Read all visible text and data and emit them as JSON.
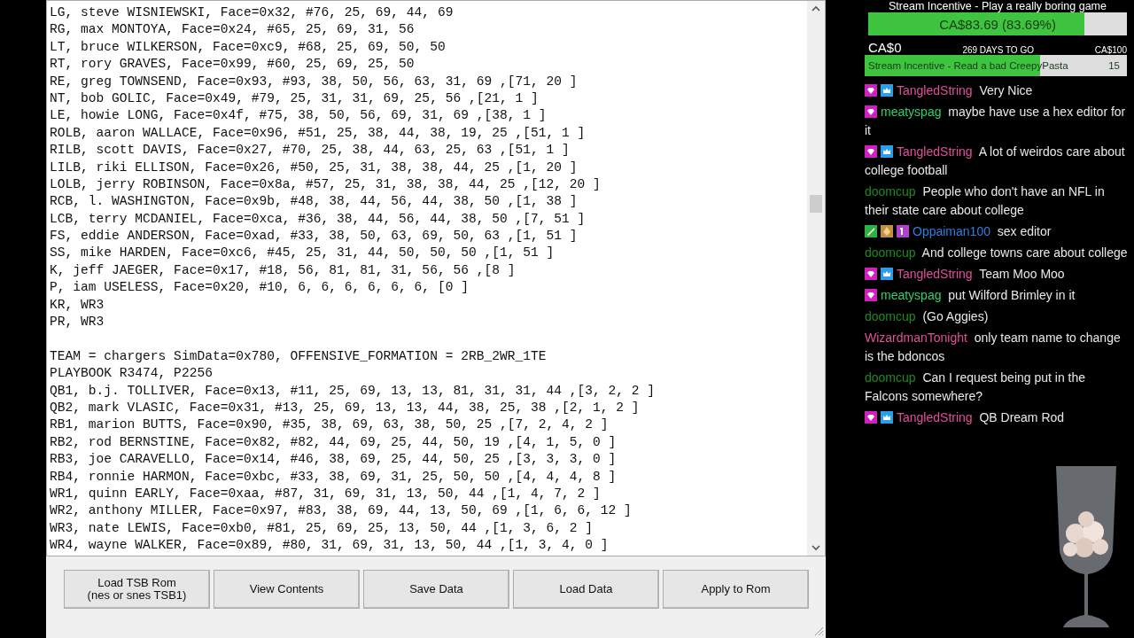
{
  "editor": {
    "blocks": [
      {
        "lines": [
          "LG, steve WISNIEWSKI, Face=0x32, #76, 25, 69, 44, 69",
          "RG, max MONTOYA, Face=0x24, #65, 25, 69, 31, 56",
          "LT, bruce WILKERSON, Face=0xc9, #68, 25, 69, 50, 50",
          "RT, rory GRAVES, Face=0x99, #60, 25, 69, 25, 50",
          "RE, greg TOWNSEND, Face=0x93, #93, 38, 50, 56, 63, 31, 69 ,[71, 20 ]",
          "NT, bob GOLIC, Face=0x49, #79, 25, 31, 31, 69, 25, 56 ,[21, 1 ]",
          "LE, howie LONG, Face=0x4f, #75, 38, 50, 56, 69, 31, 69 ,[38, 1 ]",
          "ROLB, aaron WALLACE, Face=0x96, #51, 25, 38, 44, 38, 19, 25 ,[51, 1 ]",
          "RILB, scott DAVIS, Face=0x27, #70, 25, 38, 44, 63, 25, 63 ,[51, 1 ]",
          "LILB, riki ELLISON, Face=0x26, #50, 25, 31, 38, 38, 44, 25 ,[1, 20 ]",
          "LOLB, jerry ROBINSON, Face=0x8a, #57, 25, 31, 38, 38, 44, 25 ,[12, 20 ]",
          "RCB, l. WASHINGTON, Face=0x9b, #48, 38, 44, 56, 44, 38, 50 ,[1, 38 ]",
          "LCB, terry MCDANIEL, Face=0xca, #36, 38, 44, 56, 44, 38, 50 ,[7, 51 ]",
          "FS, eddie ANDERSON, Face=0xad, #33, 38, 50, 63, 69, 50, 63 ,[1, 51 ]",
          "SS, mike HARDEN, Face=0xc6, #45, 25, 31, 44, 50, 50, 50 ,[1, 51 ]",
          "K, jeff JAEGER, Face=0x17, #18, 56, 81, 81, 31, 56, 56 ,[8 ]",
          "P, iam USELESS, Face=0x20, #10, 6, 6, 6, 6, 6, 6, [0 ]",
          "KR, WR3",
          "PR, WR3"
        ]
      },
      {
        "lines": [
          "TEAM = chargers SimData=0x780, OFFENSIVE_FORMATION = 2RB_2WR_1TE",
          "PLAYBOOK R3474, P2256",
          "QB1, b.j. TOLLIVER, Face=0x13, #11, 25, 69, 13, 13, 81, 31, 31, 44 ,[3, 2, 2 ]",
          "QB2, mark VLASIC, Face=0x31, #13, 25, 69, 13, 13, 44, 38, 25, 38 ,[2, 1, 2 ]",
          "RB1, marion BUTTS, Face=0x90, #35, 38, 69, 63, 38, 50, 25 ,[7, 2, 4, 2 ]",
          "RB2, rod BERNSTINE, Face=0x82, #82, 44, 69, 25, 44, 50, 19 ,[4, 1, 5, 0 ]",
          "RB3, joe CARAVELLO, Face=0x14, #46, 38, 69, 25, 44, 50, 25 ,[3, 3, 3, 0 ]",
          "RB4, ronnie HARMON, Face=0xbc, #33, 38, 69, 31, 25, 50, 50 ,[4, 4, 4, 8 ]",
          "WR1, quinn EARLY, Face=0xaa, #87, 31, 69, 31, 13, 50, 44 ,[1, 4, 7, 2 ]",
          "WR2, anthony MILLER, Face=0x97, #83, 38, 69, 44, 13, 50, 69 ,[1, 6, 6, 12 ]",
          "WR3, nate LEWIS, Face=0xb0, #81, 25, 69, 25, 13, 50, 44 ,[1, 3, 6, 2 ]",
          "WR4, wayne WALKER, Face=0x89, #80, 31, 69, 31, 13, 50, 44 ,[1, 3, 4, 0 ]"
        ]
      }
    ]
  },
  "buttons": [
    "Load TSB Rom\n(nes or snes TSB1)",
    "View Contents",
    "Save Data",
    "Load Data",
    "Apply to Rom"
  ],
  "overlay": {
    "title": "Stream Incentive - Play a really boring game",
    "goal": {
      "reading": "CA$83.69 (83.69%)",
      "level": 0.8369,
      "min": "CA$0",
      "remaining": "269 DAYS TO GO",
      "max": "CA$100"
    },
    "incentive": {
      "label": "Stream Incentive - Read a bad CreepyPasta",
      "count": "15",
      "level": 0.67
    }
  },
  "chat": [
    {
      "badges": [
        {
          "kind": "heart"
        },
        {
          "kind": "crown"
        }
      ],
      "user": "TangledString",
      "color": "#e0509a",
      "text": "Very Nice"
    },
    {
      "badges": [
        {
          "kind": "heart"
        }
      ],
      "user": "meatyspag",
      "color": "#30d070",
      "text": "maybe have use a hex editor for it"
    },
    {
      "badges": [
        {
          "kind": "heart"
        },
        {
          "kind": "crown"
        }
      ],
      "user": "TangledString",
      "color": "#e0509a",
      "text": "A lot of weirdos care about college football"
    },
    {
      "user": "doomcup",
      "color": "#1f8a1f",
      "text": "People who don't have an NFL in their state care about college"
    },
    {
      "badges": [
        {
          "kind": "sword"
        },
        {
          "kind": "gem"
        },
        {
          "kind": "first"
        }
      ],
      "user": "Oppaiman100",
      "color": "#2f7fe0",
      "text": "sex editor"
    },
    {
      "user": "doomcup",
      "color": "#1f8a1f",
      "text": "And college towns care about college"
    },
    {
      "badges": [
        {
          "kind": "heart"
        },
        {
          "kind": "crown"
        }
      ],
      "user": "TangledString",
      "color": "#e0509a",
      "text": "Team Moo Moo"
    },
    {
      "badges": [
        {
          "kind": "heart"
        }
      ],
      "user": "meatyspag",
      "color": "#30d070",
      "text": "put Wilford Brimley in it"
    },
    {
      "user": "doomcup",
      "color": "#1f8a1f",
      "text": "(Go Aggies)"
    },
    {
      "user": "WizardmanTonight",
      "color": "#e0509a",
      "text": "only team name to change is the bdoncos"
    },
    {
      "user": "doomcup",
      "color": "#1f8a1f",
      "text": "Can I request being put in the Falcons somewhere?"
    },
    {
      "badges": [
        {
          "kind": "heart"
        },
        {
          "kind": "crown"
        }
      ],
      "user": "TangledString",
      "color": "#e0509a",
      "text": "QB Dream Rod"
    }
  ]
}
